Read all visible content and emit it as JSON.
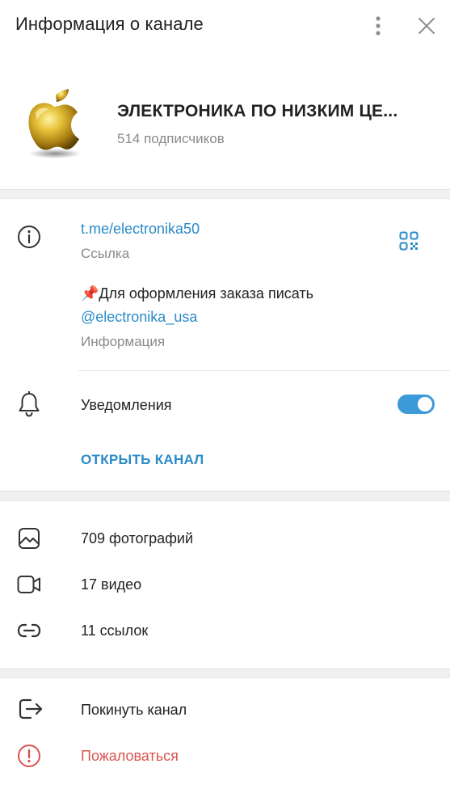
{
  "header": {
    "title": "Информация о канале"
  },
  "profile": {
    "name": "ЭЛЕКТРОНИКА ПО НИЗКИМ ЦЕ...",
    "subscribers": "514 подписчиков"
  },
  "info": {
    "link": "t.me/electronika50",
    "link_label": "Ссылка",
    "description_emoji": "📌",
    "description_text": "Для оформления заказа писать",
    "description_mention": "@electronika_usa",
    "description_label": "Информация"
  },
  "notifications": {
    "label": "Уведомления",
    "enabled": true
  },
  "open_channel_label": "ОТКРЫТЬ КАНАЛ",
  "media": {
    "photos": "709 фотографий",
    "videos": "17 видео",
    "links": "11 ссылок"
  },
  "actions": {
    "leave": "Покинуть канал",
    "report": "Пожаловаться"
  },
  "colors": {
    "accent": "#2a8ac8",
    "toggle": "#3d9ad8",
    "danger": "#d9534f",
    "muted": "#8a8a8a"
  }
}
